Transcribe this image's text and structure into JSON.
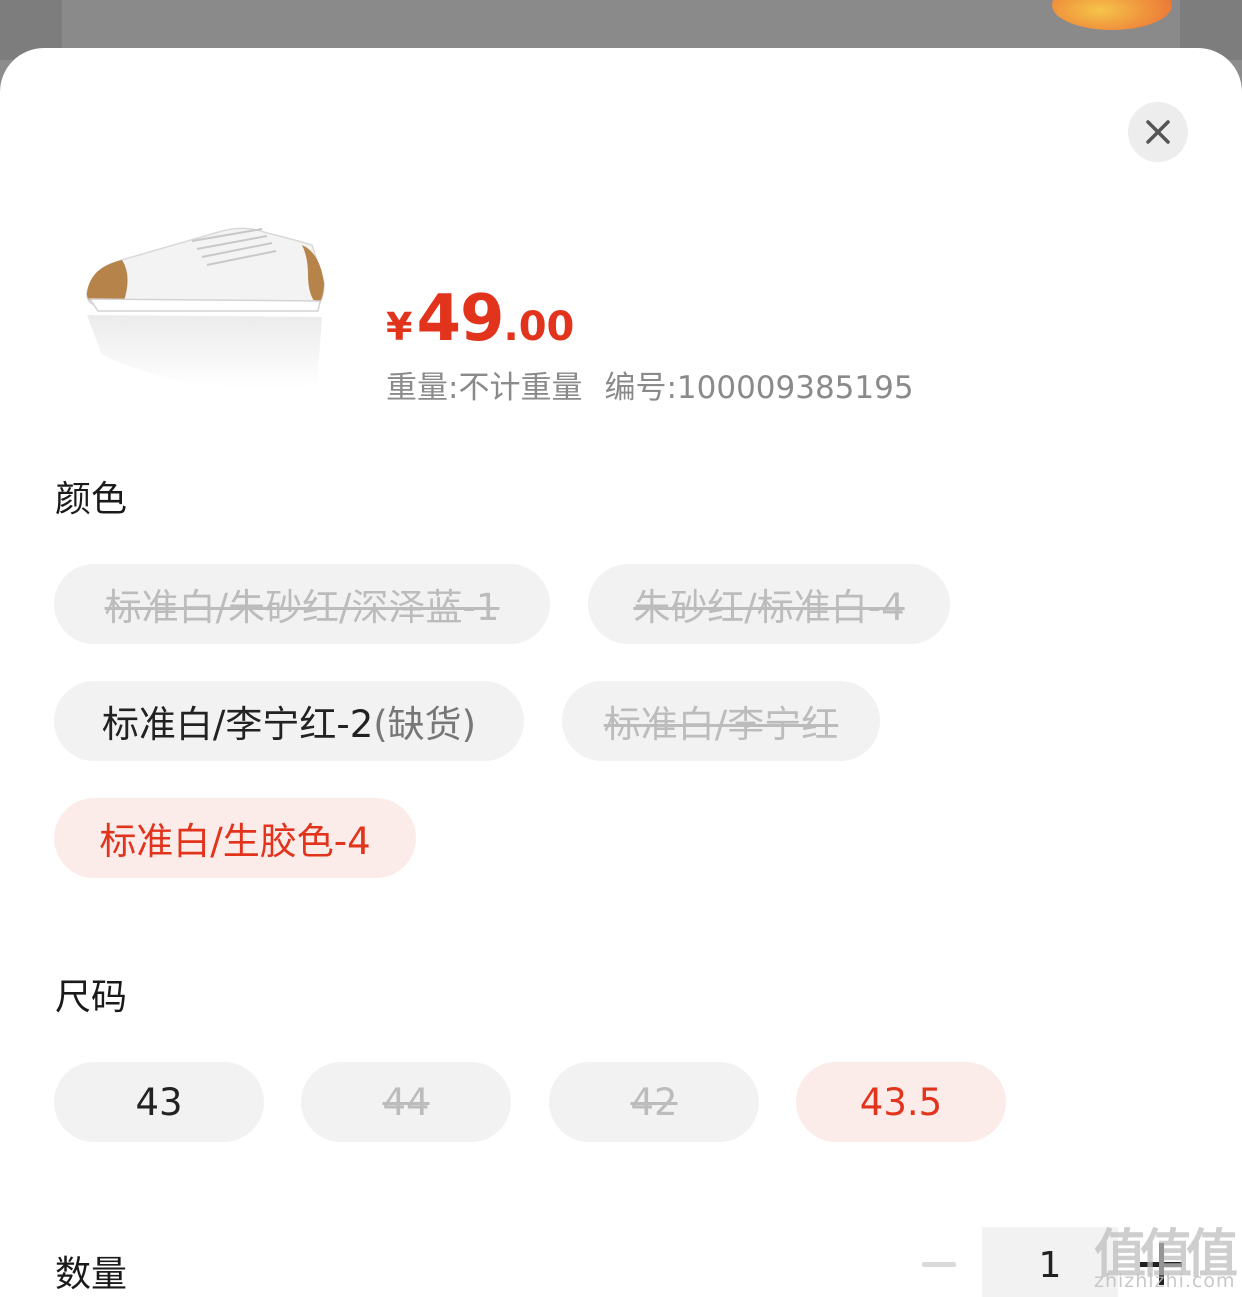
{
  "price": {
    "currency": "¥",
    "integer": "49",
    "decimal": ".00"
  },
  "meta": {
    "weight": "重量:不计重量",
    "sku": "编号:100009385195"
  },
  "color_section": {
    "title": "颜色",
    "options": [
      {
        "label": "标准白/朱砂红/深泽蓝-1",
        "state": "disabled"
      },
      {
        "label": "朱砂红/标准白-4",
        "state": "disabled"
      },
      {
        "label": "标准白/李宁红-2",
        "suffix": "(缺货)",
        "state": "out_of_stock"
      },
      {
        "label": "标准白/李宁红",
        "state": "disabled"
      },
      {
        "label": "标准白/生胶色-4",
        "state": "selected"
      }
    ]
  },
  "size_section": {
    "title": "尺码",
    "options": [
      {
        "label": "43",
        "state": "available"
      },
      {
        "label": "44",
        "state": "disabled"
      },
      {
        "label": "42",
        "state": "disabled"
      },
      {
        "label": "43.5",
        "state": "selected"
      }
    ]
  },
  "quantity_section": {
    "title": "数量",
    "value": "1"
  },
  "watermark": {
    "glyph": "值",
    "url": "zhizhizhi.com"
  },
  "colors": {
    "accent": "#e2341d",
    "chip_bg": "#f2f2f2",
    "selected_bg": "#fbecea"
  },
  "icons": {
    "close": "close-icon",
    "minus": "minus-icon",
    "plus": "plus-icon"
  }
}
